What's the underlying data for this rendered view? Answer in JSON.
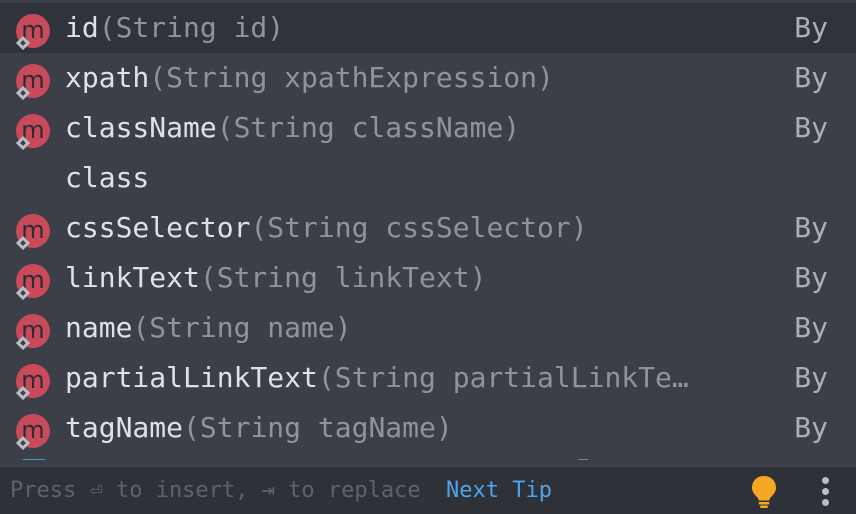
{
  "items": [
    {
      "name": "id",
      "params": "(String id)",
      "type": "By",
      "icon": "method-icon",
      "letter": "m",
      "selected": true
    },
    {
      "name": "xpath",
      "params": "(String xpathExpression)",
      "type": "By",
      "icon": "method-icon",
      "letter": "m"
    },
    {
      "name": "className",
      "params": "(String className)",
      "type": "By",
      "icon": "method-icon",
      "letter": "m"
    },
    {
      "name": "class",
      "params": "",
      "type": "",
      "icon": "",
      "letter": ""
    },
    {
      "name": "cssSelector",
      "params": "(String cssSelector)",
      "type": "By",
      "icon": "method-icon",
      "letter": "m"
    },
    {
      "name": "linkText",
      "params": "(String linkText)",
      "type": "By",
      "icon": "method-icon",
      "letter": "m"
    },
    {
      "name": "name",
      "params": "(String name)",
      "type": "By",
      "icon": "method-icon",
      "letter": "m"
    },
    {
      "name": "partialLinkText",
      "params": "(String partialLinkTe…",
      "type": "By",
      "icon": "method-icon",
      "letter": "m"
    },
    {
      "name": "tagName",
      "params": "(String tagName)",
      "type": "By",
      "icon": "method-icon",
      "letter": "m"
    }
  ],
  "footer": {
    "hint": "Press ⏎ to insert, ⇥ to replace",
    "next_tip": "Next Tip",
    "bulb_icon": "lightbulb-icon",
    "menu_icon": "more-vertical-icon"
  },
  "colors": {
    "method_badge": "#c94a5a",
    "link": "#4fa3e8",
    "bulb": "#f5a623"
  }
}
